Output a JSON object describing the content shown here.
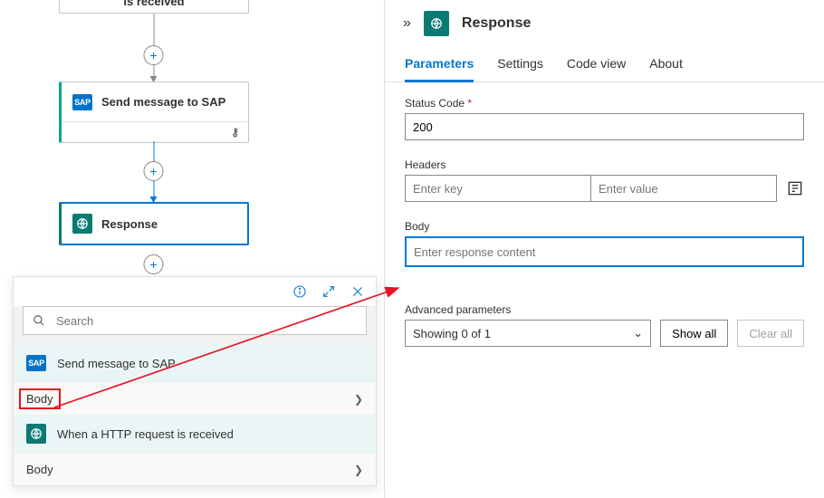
{
  "canvas": {
    "trigger_label": "is received",
    "sap_label": "Send message to SAP",
    "response_label": "Response"
  },
  "picker": {
    "search_placeholder": "Search",
    "group1_label": "Send message to SAP",
    "body1_label": "Body",
    "group2_label": "When a HTTP request is received",
    "body2_label": "Body"
  },
  "pane": {
    "title": "Response",
    "tabs": [
      "Parameters",
      "Settings",
      "Code view",
      "About"
    ],
    "status_label": "Status Code",
    "status_value": "200",
    "headers_label": "Headers",
    "headers_key_ph": "Enter key",
    "headers_val_ph": "Enter value",
    "body_label": "Body",
    "body_placeholder": "Enter response content",
    "adv_label": "Advanced parameters",
    "adv_value": "Showing 0 of 1",
    "show_all": "Show all",
    "clear_all": "Clear all"
  },
  "icons": {
    "sap_badge": "SAP"
  }
}
